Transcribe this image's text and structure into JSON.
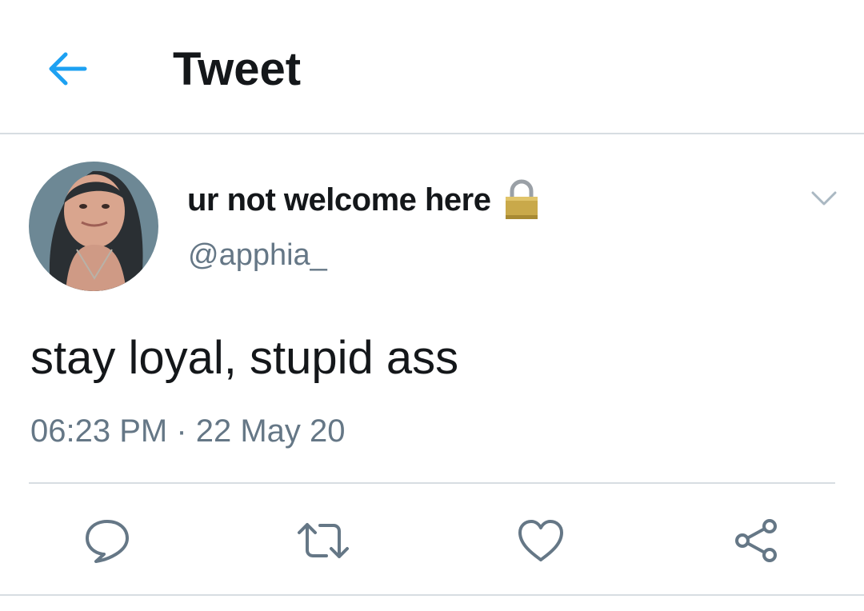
{
  "header": {
    "title": "Tweet",
    "back_icon": "arrow-left-icon"
  },
  "tweet": {
    "author": {
      "display_name": "ur not welcome here",
      "handle": "@apphia_",
      "protected_icon": "lock-icon"
    },
    "text": "stay loyal, stupid ass",
    "timestamp": "06:23 PM · 22 May 20"
  },
  "actions": [
    {
      "name": "reply",
      "icon": "comment-icon"
    },
    {
      "name": "retweet",
      "icon": "retweet-icon"
    },
    {
      "name": "like",
      "icon": "heart-icon"
    },
    {
      "name": "share",
      "icon": "share-icon"
    }
  ],
  "colors": {
    "accent": "#1da1f2",
    "text": "#14171a",
    "secondary": "#657786",
    "divider": "#d7dde2"
  }
}
